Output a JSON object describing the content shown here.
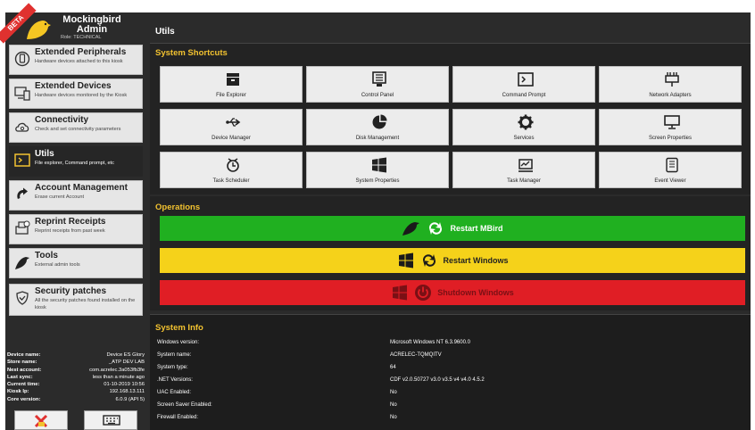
{
  "user": {
    "badge": "BETA",
    "name": "Mockingbird Admin",
    "role": "Role: TECHNICAL"
  },
  "sidebar": {
    "items": [
      {
        "title": "Extended Peripherals",
        "desc": "Hardware devices attached to this kiosk",
        "icon": "usb-device-icon"
      },
      {
        "title": "Extended Devices",
        "desc": "Hardware devices monitored by the Kiosk",
        "icon": "devices-icon"
      },
      {
        "title": "Connectivity",
        "desc": "Check and set connectivity parameters",
        "icon": "cloud-icon"
      },
      {
        "title": "Utils",
        "desc": "File explorer, Command prompt, etc",
        "icon": "terminal-icon"
      },
      {
        "title": "Account Management",
        "desc": "Erase current Account",
        "icon": "refresh-icon"
      },
      {
        "title": "Reprint Receipts",
        "desc": "Reprint receipts from past week",
        "icon": "printer-icon"
      },
      {
        "title": "Tools",
        "desc": "External admin tools",
        "icon": "bird-icon"
      },
      {
        "title": "Security patches",
        "desc": "All the security patches found installed on the kiosk",
        "icon": "shield-icon"
      }
    ]
  },
  "device_info": [
    {
      "k": "Device name:",
      "v": "Device ES Glory"
    },
    {
      "k": "Store name:",
      "v": "_ATP DEV LAB"
    },
    {
      "k": "Nest account:",
      "v": "com.acrelec.3a053fb3fe"
    },
    {
      "k": "Last sync:",
      "v": "less than a minute ago"
    },
    {
      "k": "Current time:",
      "v": "01-10-2019 10:56"
    },
    {
      "k": "Kiosk Ip:",
      "v": "192.168.13.111"
    },
    {
      "k": "Core version:",
      "v": "6.0.9 (API 5)"
    }
  ],
  "main": {
    "title": "Utils",
    "shortcuts_title": "System Shortcuts",
    "shortcuts": [
      {
        "label": "File Explorer",
        "icon": "file-explorer-icon"
      },
      {
        "label": "Control Panel",
        "icon": "control-panel-icon"
      },
      {
        "label": "Command Prompt",
        "icon": "command-prompt-icon"
      },
      {
        "label": "Network Adapters",
        "icon": "network-adapter-icon"
      },
      {
        "label": "Device Manager",
        "icon": "usb-icon"
      },
      {
        "label": "Disk Management",
        "icon": "pie-chart-icon"
      },
      {
        "label": "Services",
        "icon": "gear-icon"
      },
      {
        "label": "Screen Properties",
        "icon": "monitor-icon"
      },
      {
        "label": "Task Scheduler",
        "icon": "clock-icon"
      },
      {
        "label": "System Properties",
        "icon": "windows-logo-icon"
      },
      {
        "label": "Task Manager",
        "icon": "task-manager-icon"
      },
      {
        "label": "Event Viewer",
        "icon": "notepad-icon"
      }
    ],
    "operations_title": "Operations",
    "operations": [
      {
        "label": "Restart MBird",
        "color": "#20b020",
        "text_color": "#ffffff"
      },
      {
        "label": "Restart Windows",
        "color": "#f5d21a",
        "text_color": "#222222"
      },
      {
        "label": "Shutdown Windows",
        "color": "#e01e25",
        "text_color": "#7a1015"
      }
    ],
    "sysinfo_title": "System Info",
    "sysinfo": [
      {
        "k": "Windows version:",
        "v": "Microsoft Windows NT 6.3.9600.0"
      },
      {
        "k": "System name:",
        "v": "ACRELEC-TQMQITV"
      },
      {
        "k": "System type:",
        "v": "64"
      },
      {
        "k": ".NET Versions:",
        "v": "CDF v2.0.50727 v3.0 v3.5 v4 v4.0 4.5.2"
      },
      {
        "k": "UAC Enabled:",
        "v": "No"
      },
      {
        "k": "Screen Saver Enabled:",
        "v": "No"
      },
      {
        "k": "Firewall Enabled:",
        "v": "No"
      }
    ]
  },
  "colors": {
    "accent": "#f2c230",
    "panel": "#2b2b2b"
  }
}
